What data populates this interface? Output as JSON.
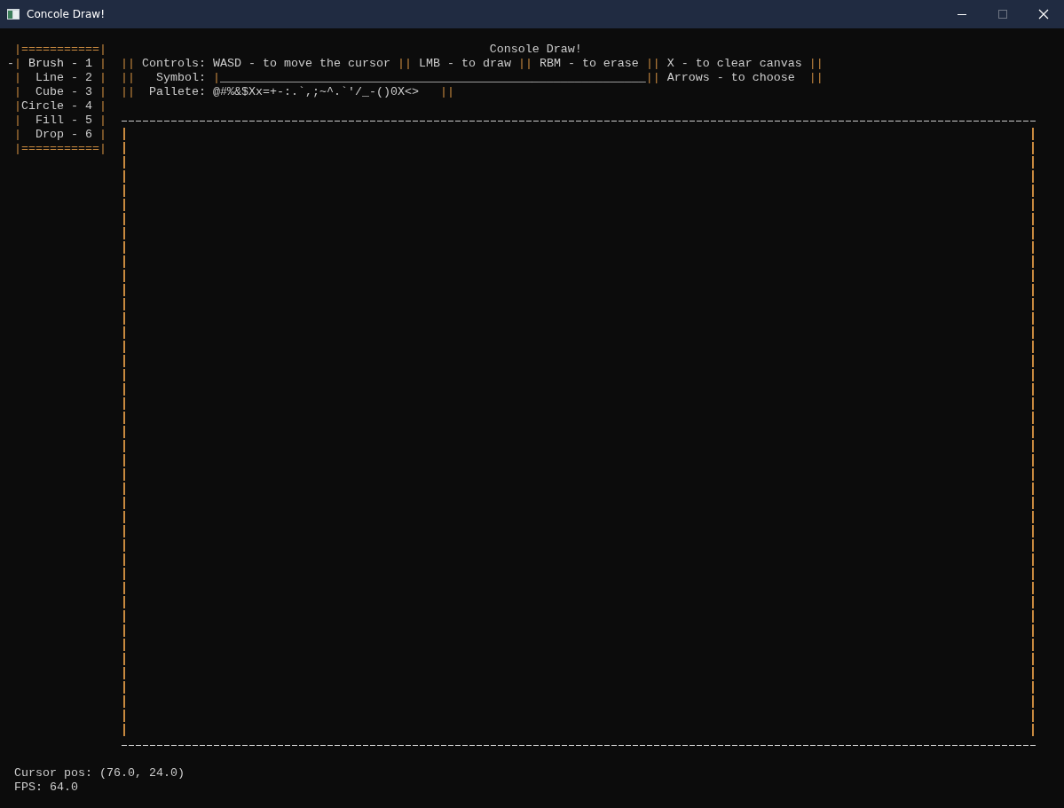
{
  "window": {
    "title": "Concole Draw!",
    "maximize_enabled": false
  },
  "menu": {
    "marker": "-",
    "frame": "|",
    "top_rule": "|===========|",
    "bottom_rule": "|===========|",
    "items": [
      {
        "label": "Brush - 1",
        "selected": true
      },
      {
        "label": "Line - 2",
        "selected": false
      },
      {
        "label": "Cube - 3",
        "selected": false
      },
      {
        "label": "Circle - 4",
        "selected": false
      },
      {
        "label": "Fill - 5",
        "selected": false
      },
      {
        "label": "Drop - 6",
        "selected": false
      }
    ]
  },
  "header": {
    "title": "Console Draw!",
    "lines": [
      {
        "parts": [
          {
            "kind": "frame",
            "text": "||"
          },
          {
            "kind": "text",
            "text": " Controls: WASD - to move the cursor "
          },
          {
            "kind": "frame",
            "text": "||"
          },
          {
            "kind": "text",
            "text": " LMB - to draw "
          },
          {
            "kind": "frame",
            "text": "||"
          },
          {
            "kind": "text",
            "text": " RBM - to erase "
          },
          {
            "kind": "frame",
            "text": "||"
          },
          {
            "kind": "text",
            "text": " X - to clear canvas "
          },
          {
            "kind": "frame",
            "text": "||"
          }
        ]
      },
      {
        "parts": [
          {
            "kind": "frame",
            "text": "||"
          },
          {
            "kind": "text",
            "text": "   Symbol: "
          },
          {
            "kind": "frame",
            "text": "|"
          },
          {
            "kind": "underline",
            "text": "____________________________________________________________"
          },
          {
            "kind": "frame",
            "text": "||"
          },
          {
            "kind": "text",
            "text": " Arrows - to choose  "
          },
          {
            "kind": "frame",
            "text": "||"
          }
        ]
      },
      {
        "parts": [
          {
            "kind": "frame",
            "text": "||"
          },
          {
            "kind": "text",
            "text": "  Pallete: "
          },
          {
            "kind": "text",
            "text": "@#%&$Xx=+-:.`,;~^.`'/_-()0X<>   "
          },
          {
            "kind": "frame",
            "text": "||"
          }
        ]
      }
    ]
  },
  "status": {
    "cursor": "Cursor pos: (76.0, 24.0)",
    "fps": "FPS: 64.0"
  }
}
